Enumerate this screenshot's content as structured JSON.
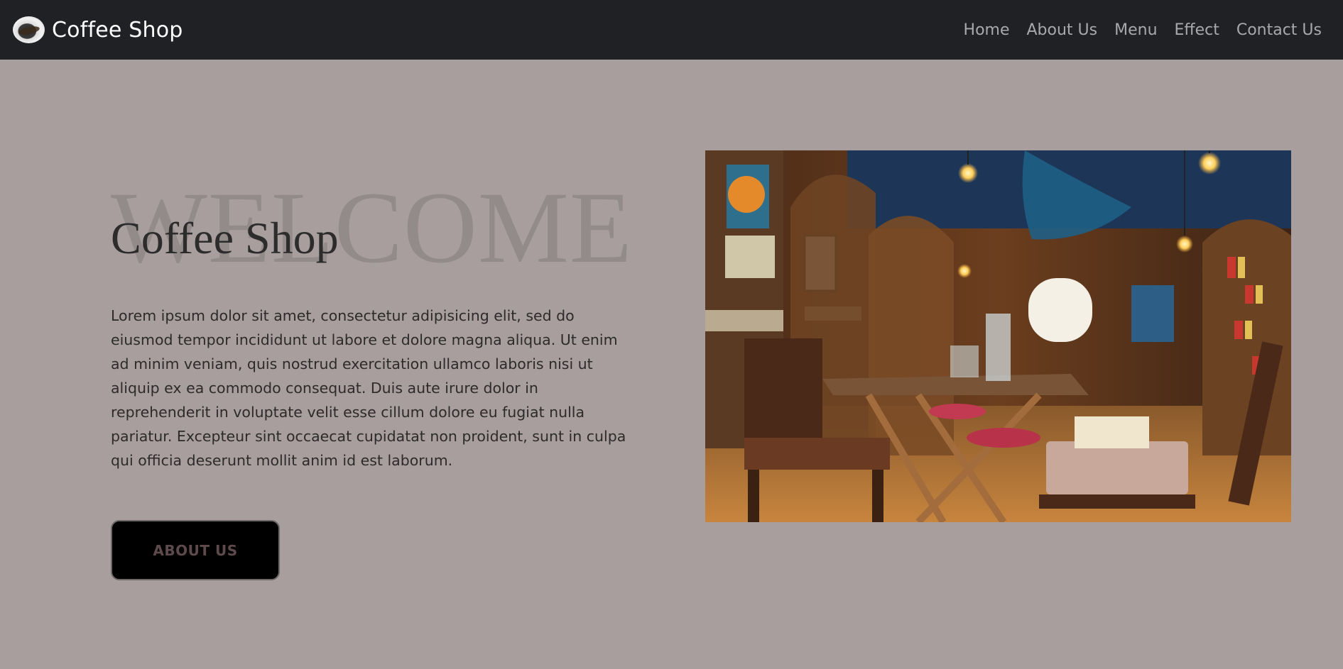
{
  "navbar": {
    "brand": "Coffee Shop",
    "links": [
      {
        "label": "Home"
      },
      {
        "label": "About Us"
      },
      {
        "label": "Menu"
      },
      {
        "label": "Effect"
      },
      {
        "label": "Contact Us"
      }
    ]
  },
  "hero": {
    "background_word": "WELCOME",
    "title": "Coffee Shop",
    "paragraph": "Lorem ipsum dolor sit amet, consectetur adipisicing elit, sed do eiusmod tempor incididunt ut labore et dolore magna aliqua. Ut enim ad minim veniam, quis nostrud exercitation ullamco laboris nisi ut aliquip ex ea commodo consequat. Duis aute irure dolor in reprehenderit in voluptate velit esse cillum dolore eu fugiat nulla pariatur. Excepteur sint occaecat cupidatat non proident, sunt in culpa qui officia deserunt mollit anim id est laborum.",
    "button_label": "ABOUT US"
  },
  "icons": {
    "logo": "coffee-cup-logo-icon"
  },
  "colors": {
    "navbar_bg": "#1f2125",
    "page_bg": "#a99e9e",
    "nav_link": "#a7a9ad",
    "button_bg": "#000000",
    "button_text": "#5e4a4a"
  }
}
